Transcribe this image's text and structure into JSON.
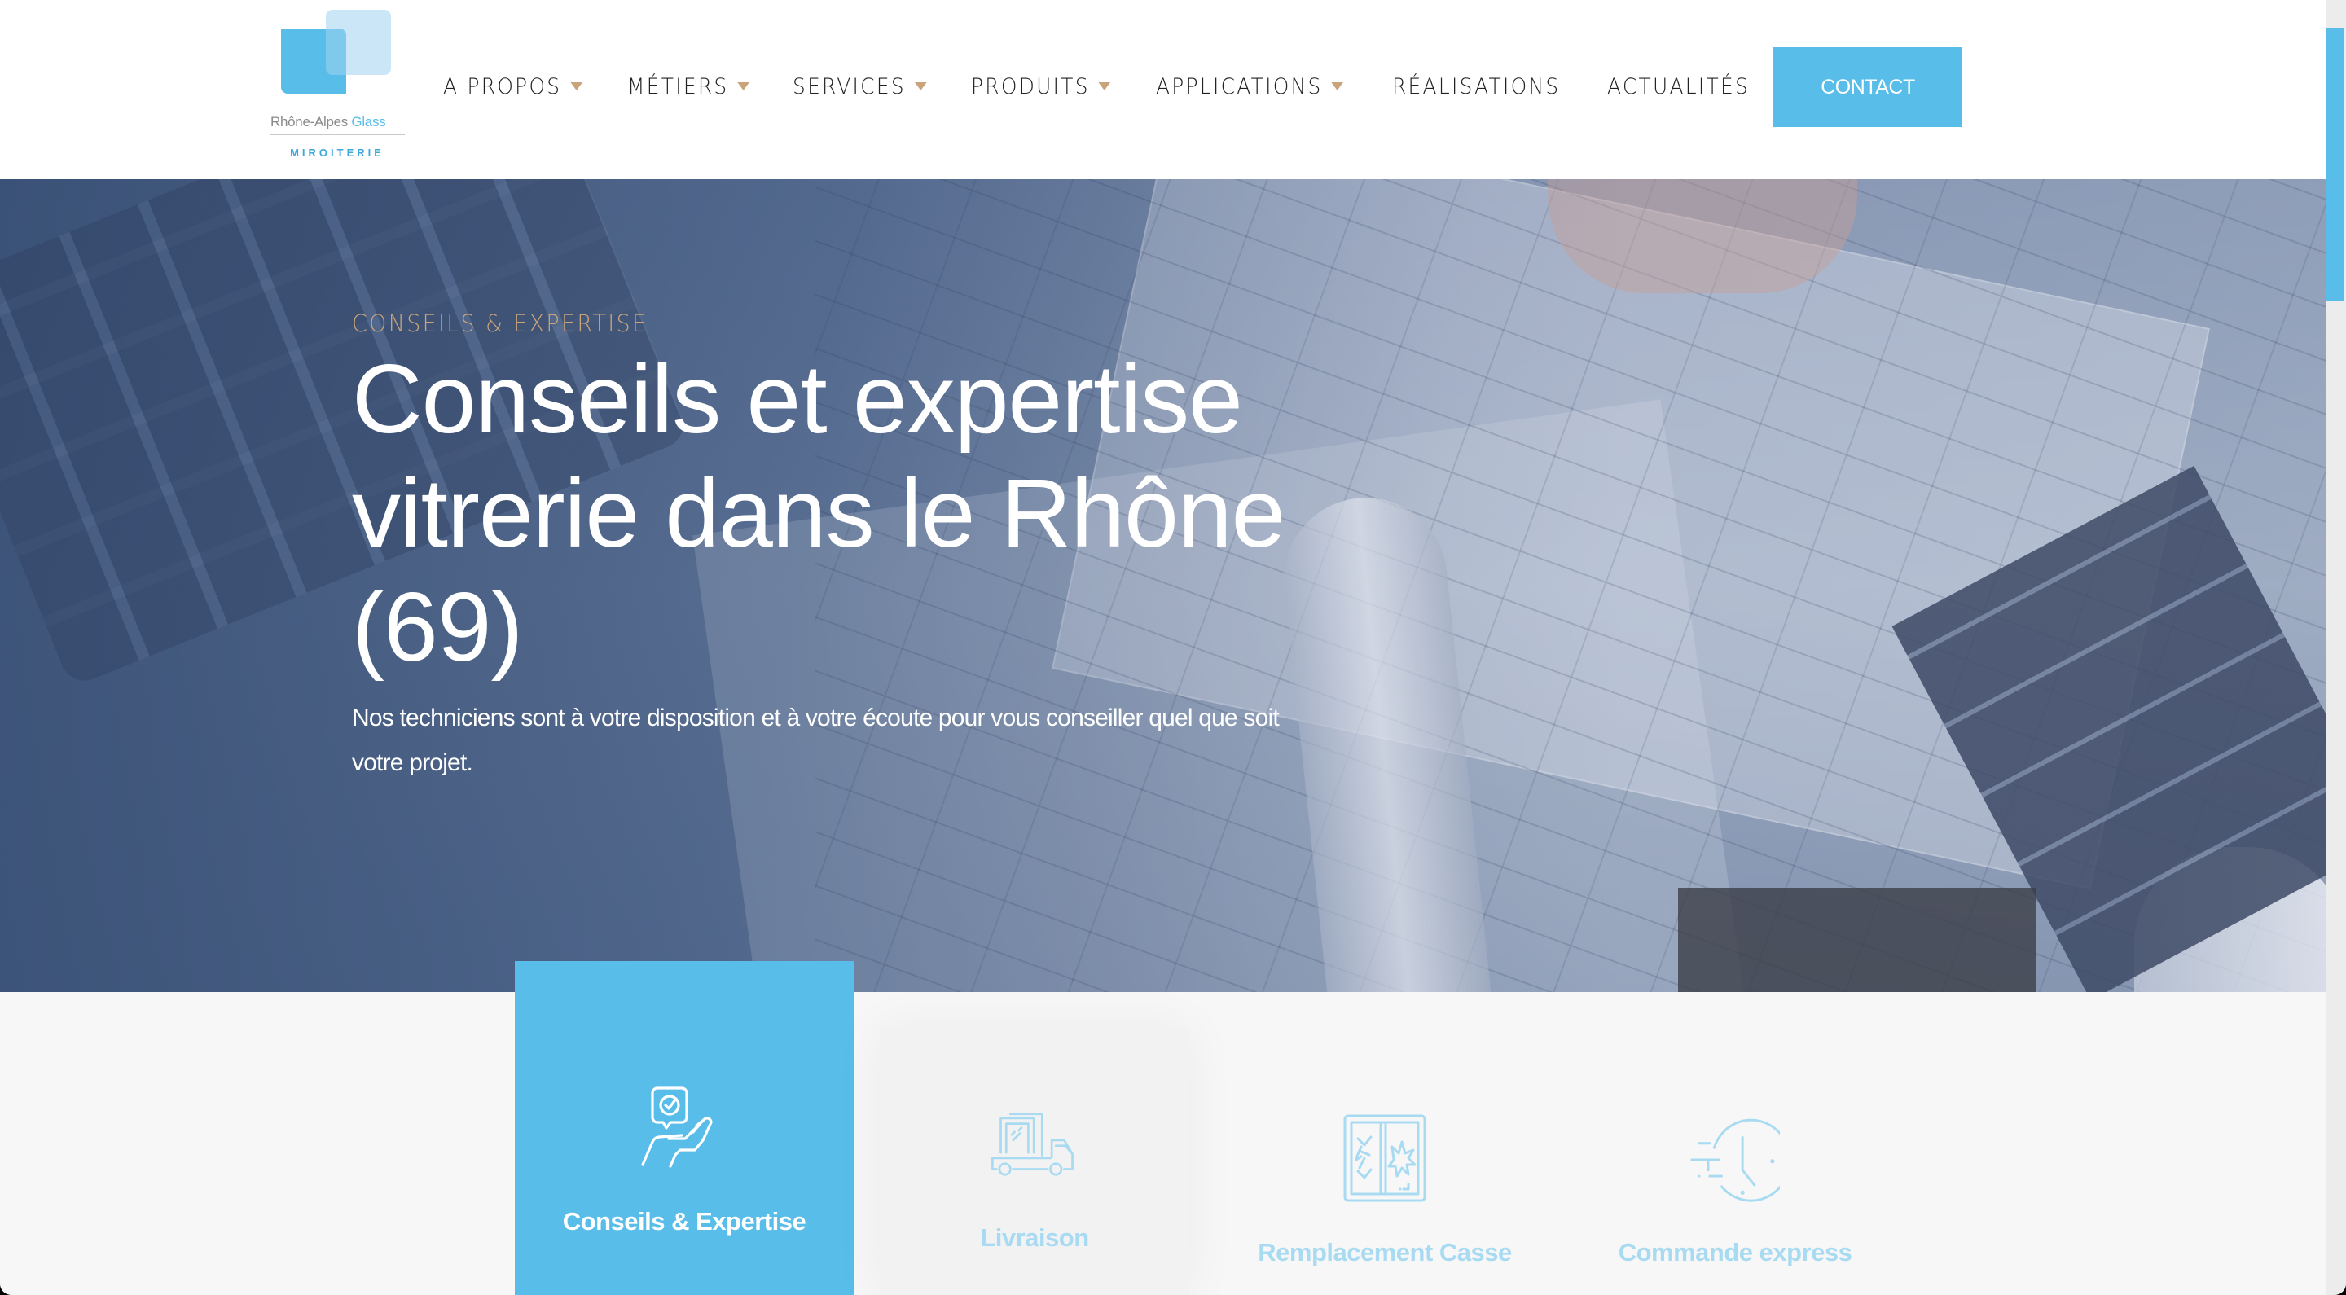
{
  "brand": {
    "name_part1": "Rhône-Alpes ",
    "name_part2": "Glass",
    "tagline": "MIROITERIE"
  },
  "nav": {
    "items": [
      {
        "label": "A PROPOS",
        "has_dropdown": true
      },
      {
        "label": "MÉTIERS",
        "has_dropdown": true
      },
      {
        "label": "SERVICES",
        "has_dropdown": true
      },
      {
        "label": "PRODUITS",
        "has_dropdown": true
      },
      {
        "label": "APPLICATIONS",
        "has_dropdown": true
      },
      {
        "label": "RÉALISATIONS",
        "has_dropdown": false
      },
      {
        "label": "ACTUALITÉS",
        "has_dropdown": false
      }
    ],
    "contact_label": "CONTACT"
  },
  "hero": {
    "eyebrow": "CONSEILS & EXPERTISE",
    "title": "Conseils et expertise vitrerie dans le Rhône (69)",
    "subtitle": "Nos techniciens sont à votre disposition et à votre écoute pour vous conseiller quel que soit votre projet."
  },
  "services": {
    "items": [
      {
        "label": "Conseils & Expertise",
        "icon": "hand-advice-icon",
        "state": "active"
      },
      {
        "label": "Livraison",
        "icon": "delivery-truck-icon",
        "state": "hover"
      },
      {
        "label": "Remplacement Casse",
        "icon": "broken-window-icon",
        "state": "default"
      },
      {
        "label": "Commande express",
        "icon": "fast-clock-icon",
        "state": "default"
      }
    ]
  },
  "colors": {
    "accent": "#58bde8",
    "gold": "#c9a47a",
    "text_dark": "#222222",
    "icon_light": "#a8dbf2"
  }
}
